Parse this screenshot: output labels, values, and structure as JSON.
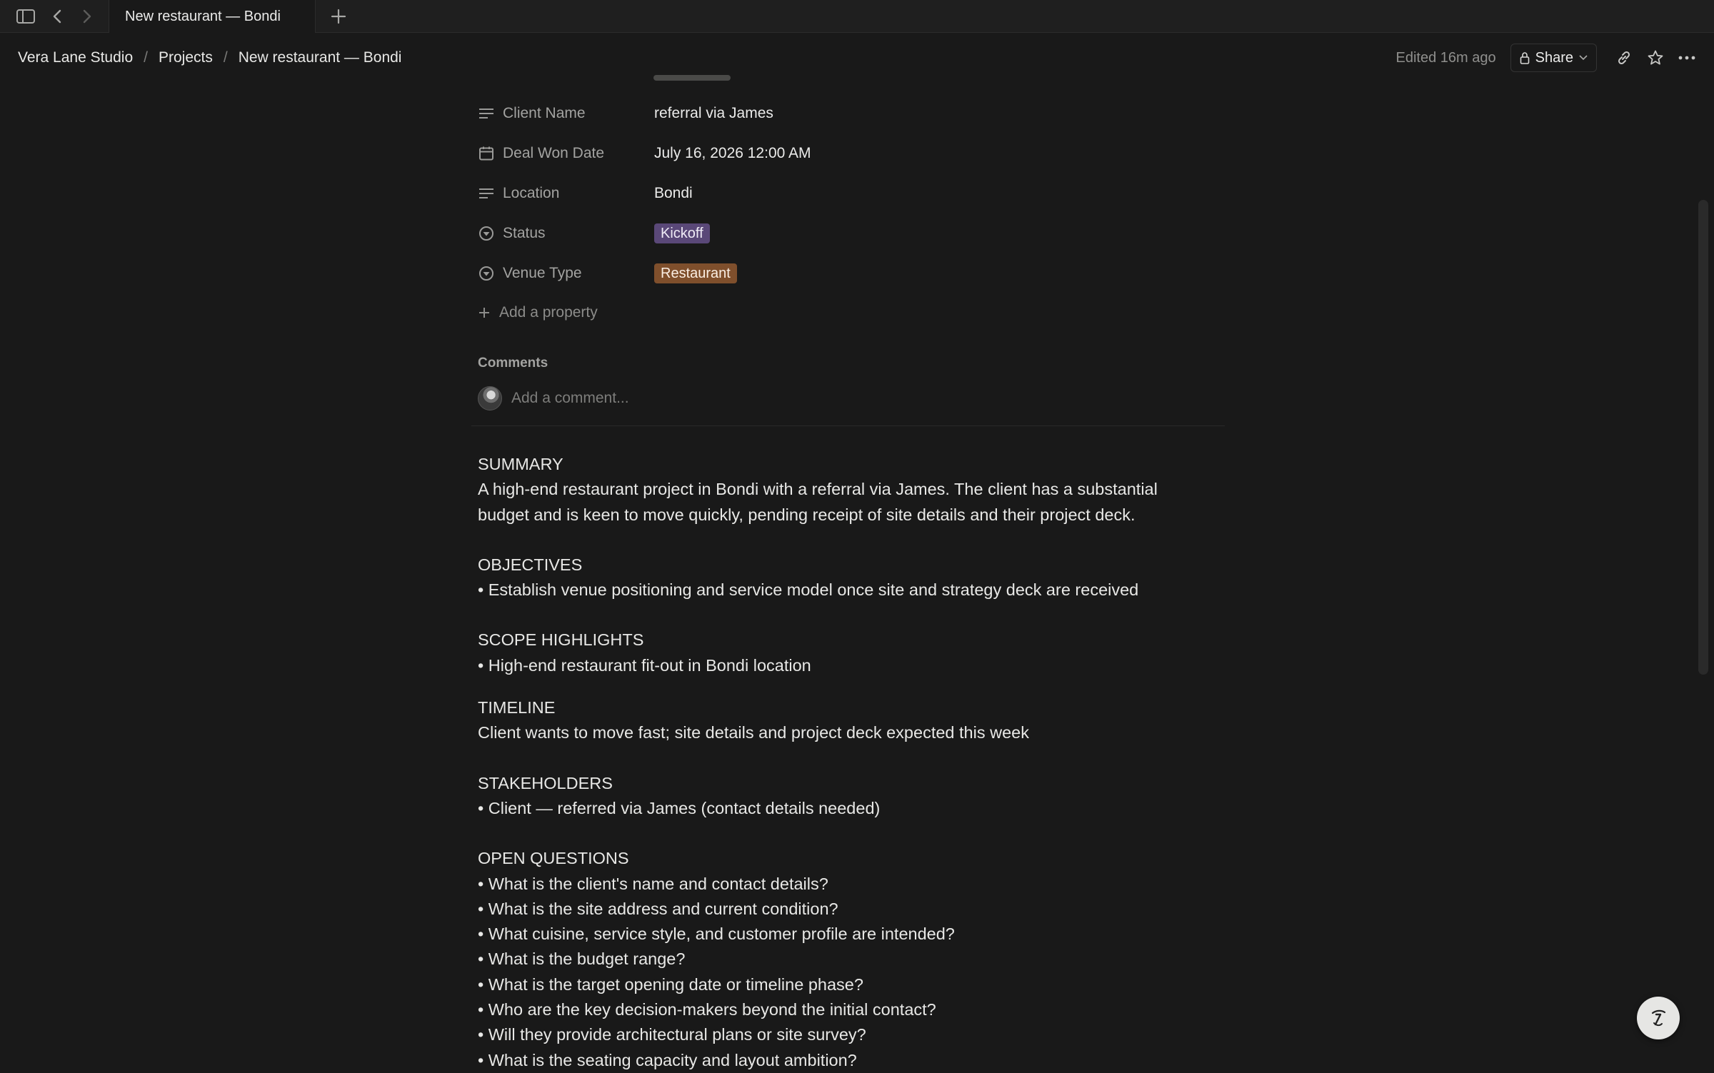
{
  "tabbar": {
    "active_tab": "New restaurant — Bondi"
  },
  "header": {
    "breadcrumb": [
      "Vera Lane Studio",
      "Projects",
      "New restaurant — Bondi"
    ],
    "edited": "Edited 16m ago",
    "share_label": "Share"
  },
  "properties": [
    {
      "icon": "text-lines-icon",
      "name": "Client Name",
      "value": "referral via James"
    },
    {
      "icon": "calendar-icon",
      "name": "Deal Won Date",
      "value": "July 16, 2026 12:00 AM"
    },
    {
      "icon": "text-lines-icon",
      "name": "Location",
      "value": "Bondi"
    },
    {
      "icon": "status-icon",
      "name": "Status",
      "value": "Kickoff",
      "tag_color": "#5a4878"
    },
    {
      "icon": "select-icon",
      "name": "Venue Type",
      "value": "Restaurant",
      "tag_color": "#7f4f2c"
    }
  ],
  "add_property": "Add a property",
  "comments": {
    "label": "Comments",
    "placeholder": "Add a comment..."
  },
  "body": {
    "summary_heading": "SUMMARY",
    "summary_lines": [
      "A high-end restaurant project in Bondi with a referral via James. The client has a substantial",
      "budget and is keen to move quickly, pending receipt of site details and their project deck."
    ],
    "objectives_heading": "OBJECTIVES",
    "objectives": [
      "• Establish venue positioning and service model once site and strategy deck are received"
    ],
    "scope_heading": "SCOPE HIGHLIGHTS",
    "scope": [
      "• High-end restaurant fit-out in Bondi location"
    ],
    "timeline_heading": "TIMELINE",
    "timeline": [
      "Client wants to move fast; site details and project deck expected this week"
    ],
    "stakeholders_heading": "STAKEHOLDERS",
    "stakeholders": [
      "• Client — referred via James (contact details needed)"
    ],
    "questions_heading": "OPEN QUESTIONS",
    "questions": [
      "• What is the client's name and contact details?",
      "• What is the site address and current condition?",
      "• What cuisine, service style, and customer profile are intended?",
      "• What is the budget range?",
      "• What is the target opening date or timeline phase?",
      "• Who are the key decision-makers beyond the initial contact?",
      "• Will they provide architectural plans or site survey?",
      "• What is the seating capacity and layout ambition?"
    ]
  },
  "colors": {
    "background": "#191919",
    "tag_kickoff": "#5a4878",
    "tag_restaurant": "#7f4f2c"
  }
}
